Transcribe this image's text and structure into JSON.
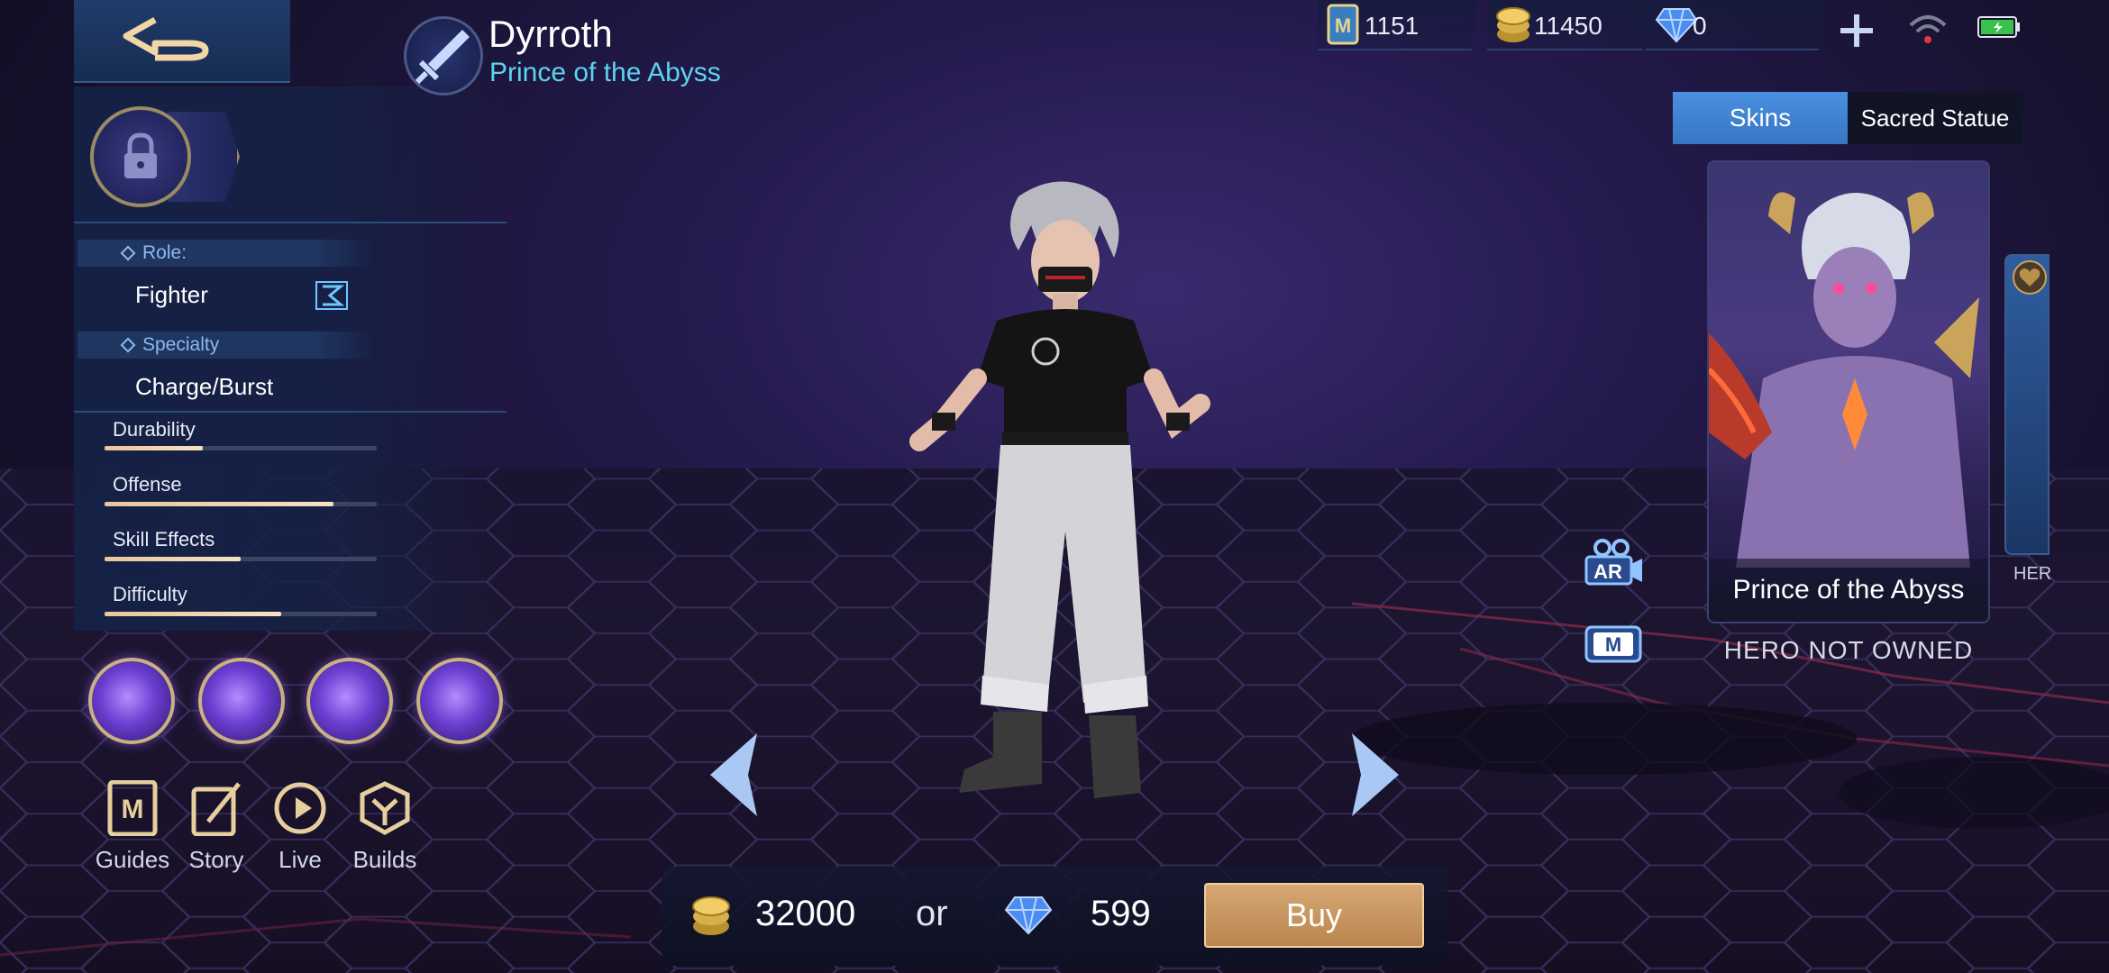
{
  "hero": {
    "name": "Dyrroth",
    "title": "Prince of the Abyss"
  },
  "currencies": {
    "tickets": "1151",
    "battle_points": "11450",
    "diamonds": "0"
  },
  "info": {
    "role_label": "Role:",
    "role_value": "Fighter",
    "specialty_label": "Specialty",
    "specialty_value": "Charge/Burst"
  },
  "stats": [
    {
      "label": "Durability",
      "value": 0.36
    },
    {
      "label": "Offense",
      "value": 0.84
    },
    {
      "label": "Skill Effects",
      "value": 0.5
    },
    {
      "label": "Difficulty",
      "value": 0.65
    }
  ],
  "nav": {
    "guides": "Guides",
    "story": "Story",
    "live": "Live",
    "builds": "Builds"
  },
  "tabs": {
    "skins": "Skins",
    "sacred_statue": "Sacred Statue"
  },
  "skin": {
    "name": "Prince of the Abyss",
    "status": "HERO NOT OWNED",
    "next_label": "HER"
  },
  "side_buttons": {
    "ar": "AR",
    "m": "M"
  },
  "purchase": {
    "bp_price": "32000",
    "or": "or",
    "diamond_price": "599",
    "buy": "Buy"
  },
  "colors": {
    "accent_blue": "#4a90e0",
    "hero_title": "#5cd4f0",
    "buy_button": "#c9975f",
    "stat_bar": "#f6e2c4"
  }
}
